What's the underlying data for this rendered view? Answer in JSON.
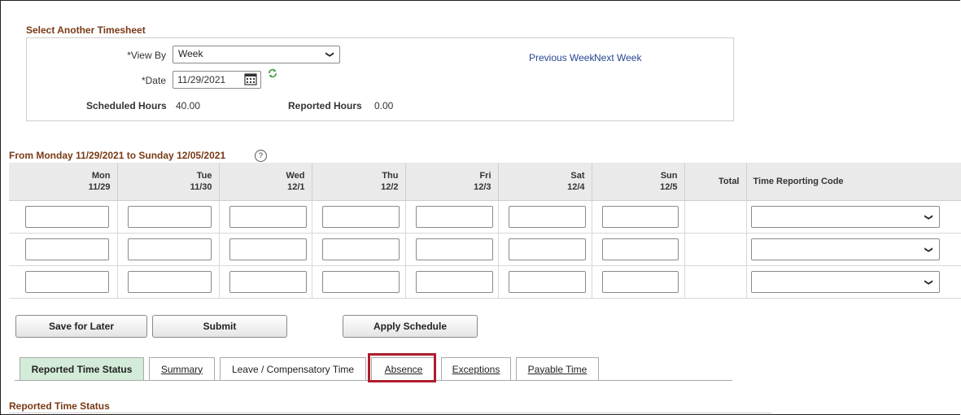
{
  "select_timesheet": {
    "title": "Select Another Timesheet",
    "view_by_label": "*View By",
    "view_by_value": "Week",
    "date_label": "*Date",
    "date_value": "11/29/2021",
    "previous_week": "Previous Week",
    "next_week": "Next Week",
    "scheduled_hours_label": "Scheduled Hours",
    "scheduled_hours_value": "40.00",
    "reported_hours_label": "Reported Hours",
    "reported_hours_value": "0.00"
  },
  "period": {
    "title": "From Monday 11/29/2021 to Sunday 12/05/2021",
    "help_icon": "?"
  },
  "grid": {
    "days": [
      {
        "day": "Mon",
        "date": "11/29"
      },
      {
        "day": "Tue",
        "date": "11/30"
      },
      {
        "day": "Wed",
        "date": "12/1"
      },
      {
        "day": "Thu",
        "date": "12/2"
      },
      {
        "day": "Fri",
        "date": "12/3"
      },
      {
        "day": "Sat",
        "date": "12/4"
      },
      {
        "day": "Sun",
        "date": "12/5"
      }
    ],
    "total_label": "Total",
    "trc_label": "Time Reporting Code"
  },
  "buttons": {
    "save_for_later": "Save for Later",
    "submit": "Submit",
    "apply_schedule": "Apply Schedule"
  },
  "tabs": {
    "reported_time_status": "Reported Time Status",
    "summary": "Summary",
    "leave_comp": "Leave / Compensatory Time",
    "absence": "Absence",
    "exceptions": "Exceptions",
    "payable_time": "Payable Time"
  },
  "reported_time_status_title": "Reported Time Status",
  "colors": {
    "section_title": "#7a3a16",
    "link": "#27458f",
    "active_tab": "#d3ecd9",
    "highlight": "#b01c2e"
  }
}
